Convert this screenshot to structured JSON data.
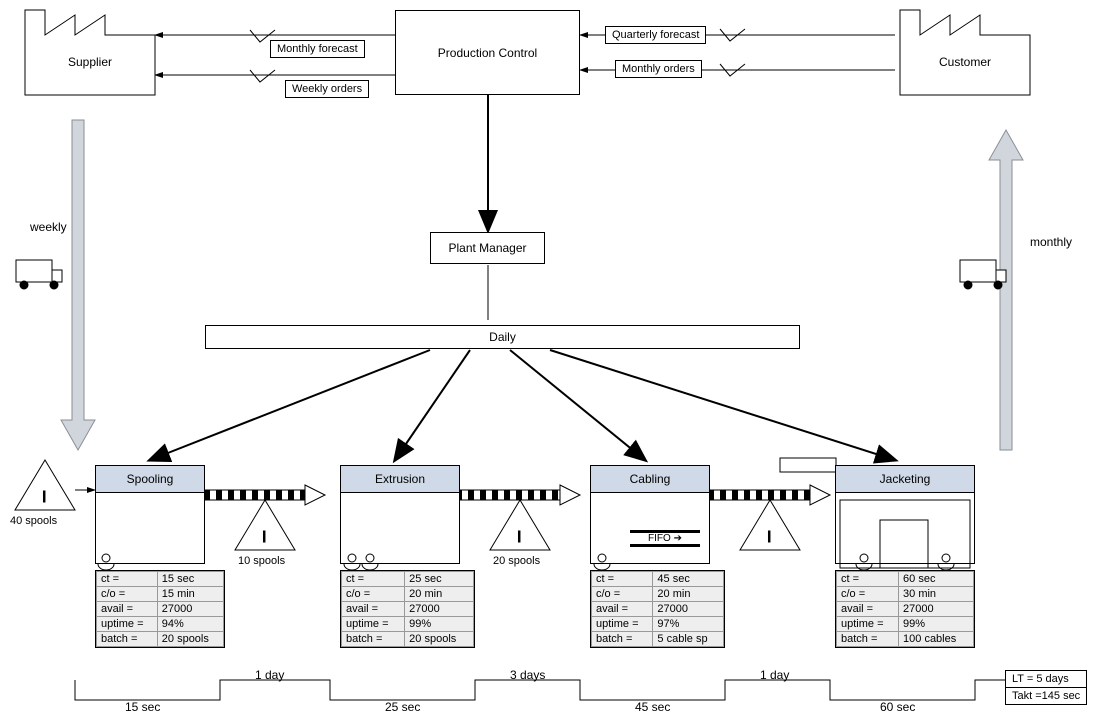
{
  "chart_data": {
    "type": "diagram",
    "diagram_type": "value-stream-map",
    "entities": {
      "supplier": "Supplier",
      "customer": "Customer",
      "production_control": "Production Control",
      "plant_manager": "Plant Manager",
      "daily": "Daily"
    },
    "info_flows": {
      "monthly_forecast": "Monthly forecast",
      "weekly_orders": "Weekly orders",
      "quarterly_forecast": "Quarterly forecast",
      "monthly_orders": "Monthly orders"
    },
    "shipments": {
      "supplier_freq": "weekly",
      "customer_freq": "monthly"
    },
    "inventories": {
      "pre_spooling": "40 spools",
      "post_spooling": "10 spools",
      "post_extrusion": "20 spools",
      "post_cabling_label": ""
    },
    "fifo_label": "FIFO",
    "processes": [
      {
        "name": "Spooling",
        "operators": 1,
        "ct": "15 sec",
        "co": "15 min",
        "avail": "27000",
        "uptime": "94%",
        "batch": "20 spools"
      },
      {
        "name": "Extrusion",
        "operators": 2,
        "ct": "25 sec",
        "co": "20 min",
        "avail": "27000",
        "uptime": "99%",
        "batch": "20 spools"
      },
      {
        "name": "Cabling",
        "operators": 1,
        "ct": "45 sec",
        "co": "20 min",
        "avail": "27000",
        "uptime": "97%",
        "batch": "5 cable sp"
      },
      {
        "name": "Jacketing",
        "operators": 2,
        "ct": "60 sec",
        "co": "30 min",
        "avail": "27000",
        "uptime": "99%",
        "batch": "100 cables"
      }
    ],
    "labels": {
      "ct": "ct =",
      "co": "c/o =",
      "avail": "avail =",
      "uptime": "uptime =",
      "batch": "batch ="
    },
    "timeline": {
      "lead_times": [
        "1 day",
        "3 days",
        "1 day"
      ],
      "cycle_times": [
        "15 sec",
        "25 sec",
        "45 sec",
        "60 sec"
      ],
      "summary": {
        "lt": "LT = 5 days",
        "takt": "Takt =145 sec"
      }
    }
  }
}
